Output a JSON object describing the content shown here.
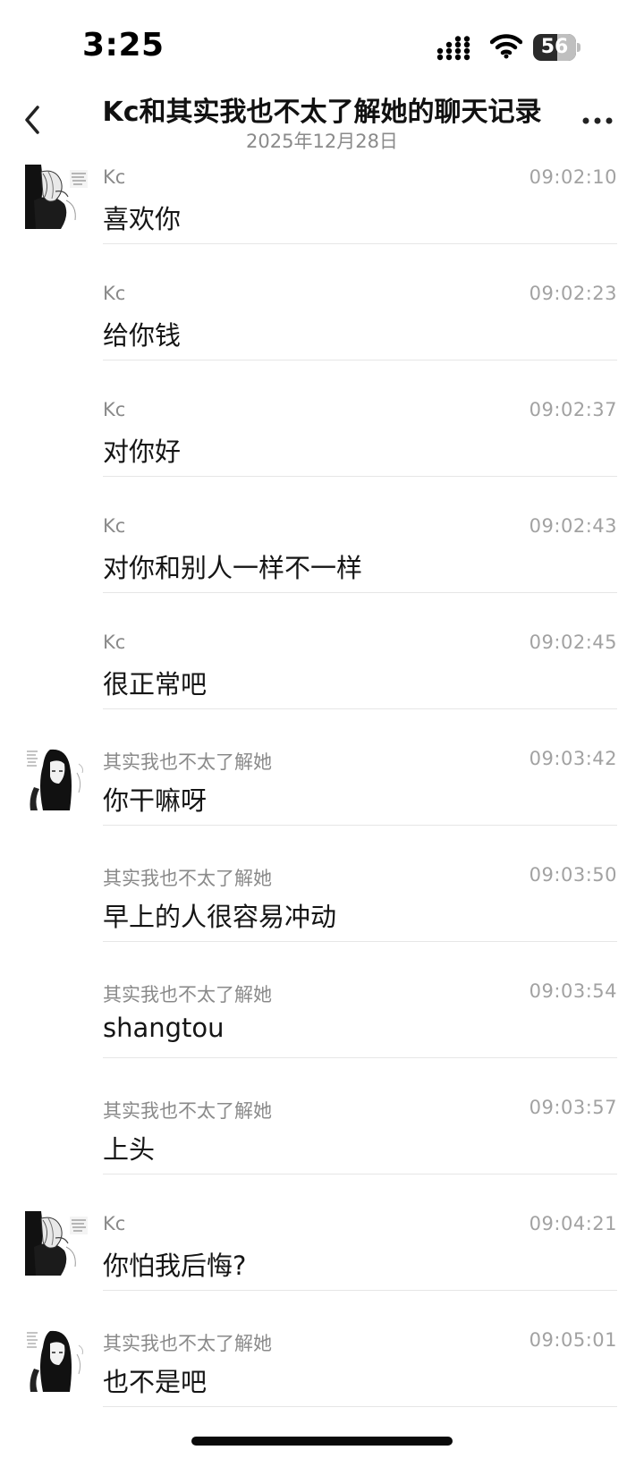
{
  "status_bar": {
    "time": "3:25",
    "battery": "56",
    "battery_level": 0.56
  },
  "nav": {
    "title": "Kc和其实我也不太了解她的聊天记录",
    "subtitle": "2025年12月28日",
    "back_icon": "chevron-left-icon",
    "more_icon": "more-dots-icon"
  },
  "messages": [
    {
      "sender": "Kc",
      "time": "09:02:10",
      "text": "喜欢你",
      "avatar": "manga-avatar-kc"
    },
    {
      "sender": "Kc",
      "time": "09:02:23",
      "text": "给你钱",
      "avatar": ""
    },
    {
      "sender": "Kc",
      "time": "09:02:37",
      "text": "对你好",
      "avatar": ""
    },
    {
      "sender": "Kc",
      "time": "09:02:43",
      "text": "对你和别人一样不一样",
      "avatar": ""
    },
    {
      "sender": "Kc",
      "time": "09:02:45",
      "text": "很正常吧",
      "avatar": ""
    },
    {
      "sender": "其实我也不太了解她",
      "time": "09:03:42",
      "text": "你干嘛呀",
      "avatar": "manga-avatar-girl"
    },
    {
      "sender": "其实我也不太了解她",
      "time": "09:03:50",
      "text": "早上的人很容易冲动",
      "avatar": ""
    },
    {
      "sender": "其实我也不太了解她",
      "time": "09:03:54",
      "text": "shangtou",
      "avatar": ""
    },
    {
      "sender": "其实我也不太了解她",
      "time": "09:03:57",
      "text": "上头",
      "avatar": ""
    },
    {
      "sender": "Kc",
      "time": "09:04:21",
      "text": "你怕我后悔?",
      "avatar": "manga-avatar-kc"
    },
    {
      "sender": "其实我也不太了解她",
      "time": "09:05:01",
      "text": "也不是吧",
      "avatar": "manga-avatar-girl"
    }
  ]
}
